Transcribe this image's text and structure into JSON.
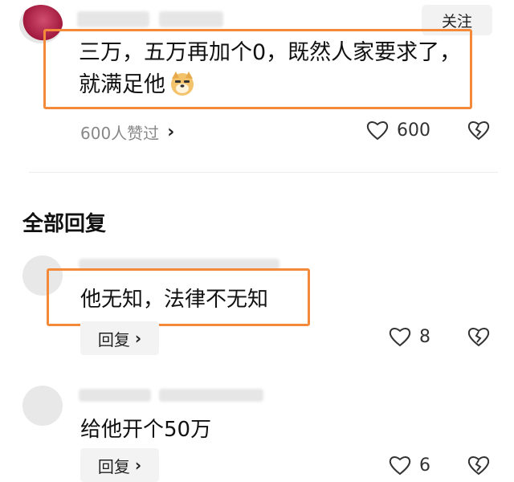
{
  "top_comment": {
    "follow_label": "关注",
    "text_line1": "三万，五万再加个0，既然人家要求了，",
    "text_line2": "就满足他",
    "emoji_icon": "doge-emoji",
    "likes_summary": "600人赞过",
    "like_count": "600"
  },
  "replies_section": {
    "title": "全部回复",
    "reply_button_label": "回复",
    "items": [
      {
        "text": "他无知，法律不无知",
        "like_count": "8"
      },
      {
        "text": "给他开个50万",
        "like_count": "6"
      }
    ]
  },
  "colors": {
    "highlight": "#f28a3a",
    "avatar_top": "#b8294f"
  },
  "icons": [
    "heart-icon",
    "broken-heart-icon",
    "chevron-right-icon"
  ]
}
